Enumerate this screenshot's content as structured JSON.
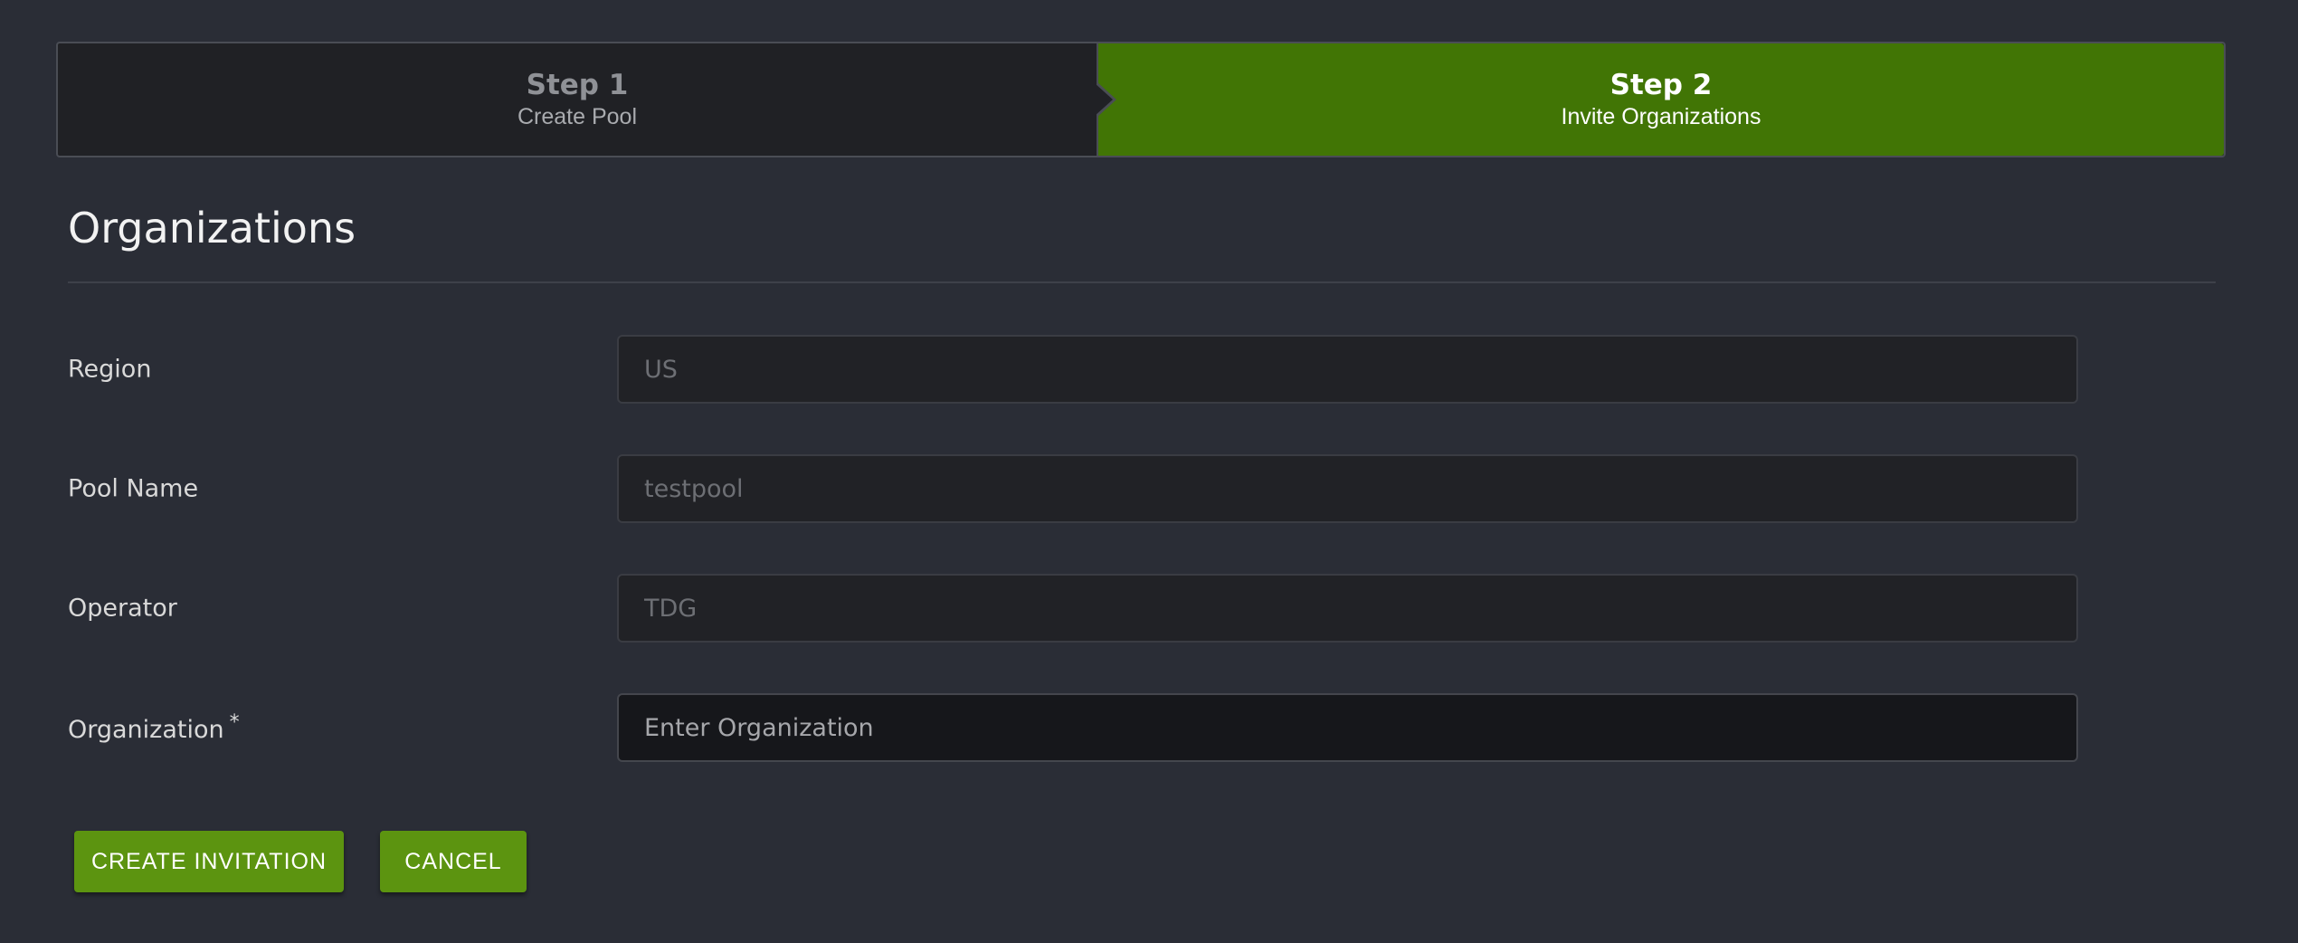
{
  "stepper": {
    "steps": [
      {
        "title": "Step 1",
        "subtitle": "Create Pool",
        "state": "complete"
      },
      {
        "title": "Step 2",
        "subtitle": "Invite Organizations",
        "state": "active"
      }
    ],
    "active_color": "#417505"
  },
  "page": {
    "title": "Organizations"
  },
  "form": {
    "region": {
      "label": "Region",
      "value": "US"
    },
    "pool_name": {
      "label": "Pool Name",
      "value": "testpool"
    },
    "operator": {
      "label": "Operator",
      "value": "TDG"
    },
    "organization": {
      "label": "Organization",
      "required_mark": "*",
      "placeholder": "Enter Organization",
      "value": ""
    }
  },
  "actions": {
    "create_label": "CREATE INVITATION",
    "cancel_label": "CANCEL",
    "button_color": "#5c9410"
  }
}
